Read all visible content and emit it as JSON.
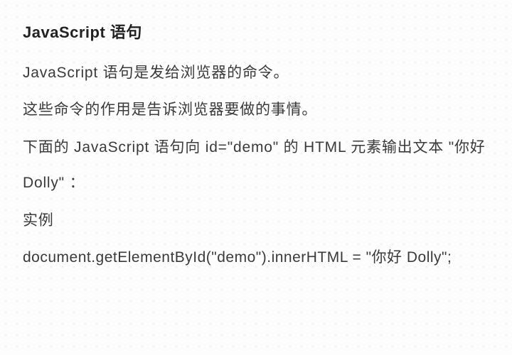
{
  "heading": "JavaScript 语句",
  "paragraphs": {
    "p1": "JavaScript 语句是发给浏览器的命令。",
    "p2": "这些命令的作用是告诉浏览器要做的事情。",
    "p3": "下面的 JavaScript 语句向 id=\"demo\" 的 HTML 元素输出文本 \"你好 Dolly\" ：",
    "example_label": "实例",
    "code": "document.getElementById(\"demo\").innerHTML = \"你好 Dolly\";"
  }
}
